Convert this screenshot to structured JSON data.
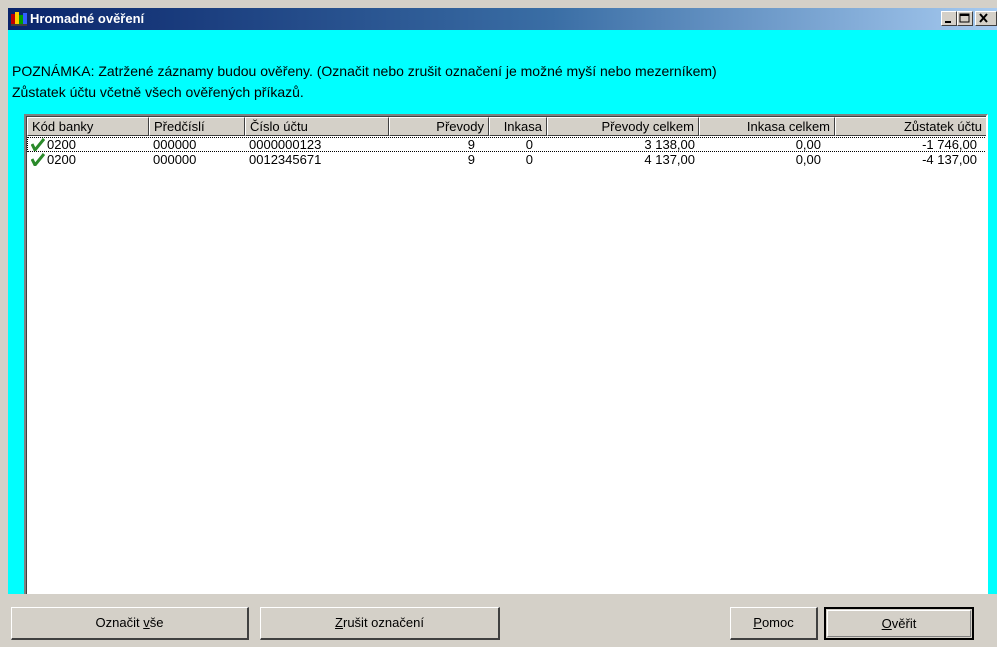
{
  "window": {
    "title": "Hromadné ověření",
    "controls": [
      "minimize-icon",
      "maximize-icon",
      "close-icon"
    ]
  },
  "notes": {
    "line1": "POZNÁMKA: Zatržené záznamy budou ověřeny. (Označit nebo zrušit označení je možné myší nebo mezerníkem)",
    "line2": "Zůstatek účtu včetně všech ověřených příkazů."
  },
  "table": {
    "columns": [
      "Kód banky",
      "Předčíslí",
      "Číslo účtu",
      "Převody",
      "Inkasa",
      "Převody celkem",
      "Inkasa celkem",
      "Zůstatek účtu"
    ],
    "rows": [
      {
        "checked": true,
        "kod_banky": "0200",
        "predcisli": "000000",
        "cislo_uctu": "0000000123",
        "prevody": "9",
        "inkasa": "0",
        "prevody_celkem": "3 138,00",
        "inkasa_celkem": "0,00",
        "zustatek": "-1 746,00"
      },
      {
        "checked": true,
        "kod_banky": "0200",
        "predcisli": "000000",
        "cislo_uctu": "0012345671",
        "prevody": "9",
        "inkasa": "0",
        "prevody_celkem": "4 137,00",
        "inkasa_celkem": "0,00",
        "zustatek": "-4 137,00"
      }
    ]
  },
  "buttons": {
    "mark_all": {
      "pre": "Označit ",
      "accel": "v",
      "post": "še"
    },
    "unmark": {
      "pre": "",
      "accel": "Z",
      "post": "rušit označení"
    },
    "help": {
      "pre": "",
      "accel": "P",
      "post": "omoc"
    },
    "verify": {
      "pre": "",
      "accel": "O",
      "post": "věřit"
    }
  },
  "colors": {
    "client_background": "#00ffff",
    "check_mark": "#2a8a2a",
    "titlebar_start": "#0a246a"
  }
}
